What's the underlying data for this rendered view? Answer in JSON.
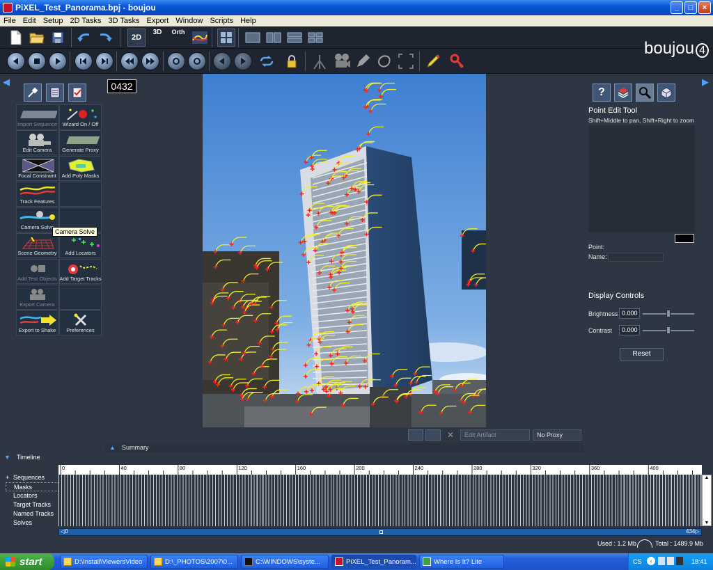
{
  "window": {
    "title": "PiXEL_Test_Panorama.bpj - boujou",
    "minimize": "_",
    "maximize": "□",
    "close": "×"
  },
  "menu": [
    "File",
    "Edit",
    "Setup",
    "2D Tasks",
    "3D Tasks",
    "Export",
    "Window",
    "Scripts",
    "Help"
  ],
  "toolbar": {
    "btn_2d": "2D",
    "btn_3d": "3D",
    "btn_orth": "Orth"
  },
  "brand": {
    "text": "boujou",
    "num": "4"
  },
  "viewport": {
    "frame_counter": "0432",
    "edit_artifact": "Edit Artifact",
    "proxy": "No Proxy",
    "summary": "Summary"
  },
  "tools": [
    {
      "label": "Import Sequence",
      "disabled": true,
      "icon": "film-strip-icon"
    },
    {
      "label": "Wizard On / Off",
      "disabled": false,
      "icon": "wizard-icon"
    },
    {
      "label": "Edit Camera",
      "disabled": false,
      "icon": "camera-icon"
    },
    {
      "label": "Generate Proxy",
      "disabled": false,
      "icon": "proxy-film-icon"
    },
    {
      "label": "Focal Constraint",
      "disabled": false,
      "icon": "focal-icon"
    },
    {
      "label": "Add Poly Masks",
      "disabled": false,
      "icon": "poly-mask-icon"
    },
    {
      "label": "Track Features",
      "disabled": false,
      "icon": "track-icon"
    },
    {
      "label": "",
      "disabled": false,
      "icon": ""
    },
    {
      "label": "Camera Solve",
      "disabled": false,
      "icon": "camera-solve-icon"
    },
    {
      "label": "",
      "disabled": false,
      "icon": ""
    },
    {
      "label": "Scene Geometry",
      "disabled": false,
      "icon": "grid-icon"
    },
    {
      "label": "Add Locators",
      "disabled": false,
      "icon": "locators-icon"
    },
    {
      "label": "Add Test Objects",
      "disabled": true,
      "icon": "test-objects-icon"
    },
    {
      "label": "Add Target Tracks",
      "disabled": false,
      "icon": "target-icon"
    },
    {
      "label": "Export Camera",
      "disabled": true,
      "icon": "export-camera-icon"
    },
    {
      "label": "",
      "disabled": false,
      "icon": ""
    },
    {
      "label": "Export to Shake",
      "disabled": false,
      "icon": "export-shake-icon"
    },
    {
      "label": "Preferences",
      "disabled": false,
      "icon": "preferences-icon"
    }
  ],
  "tooltip": "Camera Solve",
  "right_panel": {
    "title": "Point Edit Tool",
    "help": "Shift+Middle to pan, Shift+Right to zoom",
    "point_label": "Point:",
    "name_label": "Name:",
    "display_controls": "Display Controls",
    "brightness_label": "Brightness",
    "brightness_value": "0.000",
    "contrast_label": "Contrast",
    "contrast_value": "0.000",
    "reset": "Reset"
  },
  "timeline": {
    "header": "Timeline",
    "tree": [
      "Sequences",
      "Masks",
      "Locators",
      "Target Tracks",
      "Named Tracks",
      "Solves"
    ],
    "ticks": [
      "0",
      "40",
      "80",
      "120",
      "160",
      "200",
      "240",
      "280",
      "320",
      "360",
      "400"
    ],
    "range_start": "0",
    "range_end": "434",
    "used": "Used : 1.2 Mb",
    "total": "Total : 1489.9 Mb"
  },
  "taskbar": {
    "start": "start",
    "tasks": [
      "D:\\Install\\ViewersVideo",
      "D:\\_PHOTOS\\2007\\0...",
      "C:\\WINDOWS\\syste...",
      "PiXEL_Test_Panoram...",
      "Where Is It? Lite"
    ],
    "lang": "CS",
    "clock": "18:41"
  }
}
